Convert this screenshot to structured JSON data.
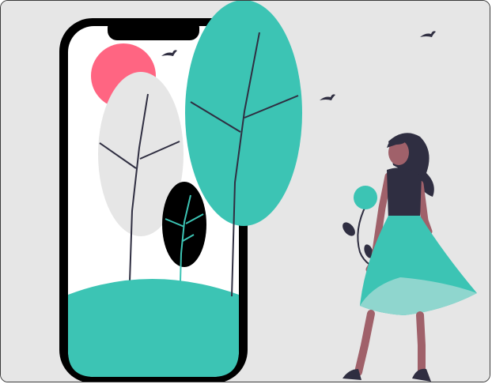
{
  "scene": {
    "background": "#e6e6e6",
    "colors": {
      "teal": "#3cc4b4",
      "teal_light": "#8fd6ce",
      "coral": "#ff6582",
      "grey_leaf": "#e6e6e6",
      "dark": "#2f2e41",
      "skin": "#a0616a",
      "phone_black": "#000000",
      "screen": "#ffffff"
    },
    "icons": [
      "smartphone-icon",
      "tree-icon",
      "bird-icon",
      "woman-figure-icon",
      "flower-icon",
      "sun-icon"
    ]
  }
}
